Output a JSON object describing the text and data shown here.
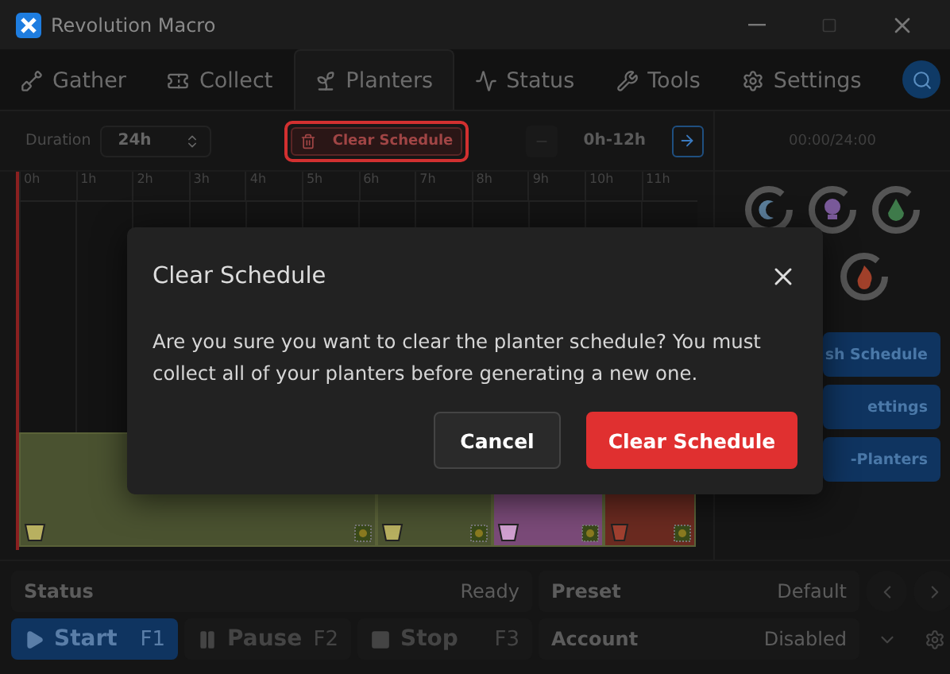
{
  "window": {
    "title": "Revolution Macro"
  },
  "tabs": [
    {
      "label": "Gather",
      "selected": false
    },
    {
      "label": "Collect",
      "selected": false
    },
    {
      "label": "Planters",
      "selected": true
    },
    {
      "label": "Status",
      "selected": false
    },
    {
      "label": "Tools",
      "selected": false
    },
    {
      "label": "Settings",
      "selected": false
    }
  ],
  "toolbar": {
    "duration_label": "Duration",
    "duration_value": "24h",
    "clear_button": "Clear Schedule",
    "range": "0h-12h",
    "clock": "00:00/24:00"
  },
  "timeline": {
    "hours": [
      "0h",
      "1h",
      "2h",
      "3h",
      "4h",
      "5h",
      "6h",
      "7h",
      "8h",
      "9h",
      "10h",
      "11h"
    ],
    "planters": [
      {
        "color": "#4a5230",
        "kind": "bucket"
      },
      {
        "color": "#4a5230",
        "kind": "bucket"
      },
      {
        "color": "#7a4a78",
        "kind": "bowl"
      },
      {
        "color": "#6a2a20",
        "kind": "pot"
      }
    ]
  },
  "fields": [
    {
      "kind": "moon",
      "color": "#5a7d9a"
    },
    {
      "kind": "bulb",
      "color": "#7a5a9a"
    },
    {
      "kind": "drop",
      "color": "#3e7a4a"
    },
    {
      "kind": "flame",
      "color": "#a0402a"
    }
  ],
  "side_buttons": [
    "sh Schedule",
    "ettings",
    "-Planters"
  ],
  "dialog": {
    "title": "Clear Schedule",
    "message": "Are you sure you want to clear the planter schedule? You must collect all of your planters before generating a new one.",
    "buttons": [
      {
        "label": "Cancel",
        "kind": "secondary"
      },
      {
        "label": "Clear Schedule",
        "kind": "danger"
      }
    ]
  },
  "status": {
    "label": "Status",
    "value": "Ready"
  },
  "preset": {
    "label": "Preset",
    "value": "Default"
  },
  "controls": [
    {
      "label": "Start",
      "key": "F1",
      "kind": "play",
      "selected": true
    },
    {
      "label": "Pause",
      "key": "F2",
      "kind": "pause",
      "selected": false
    },
    {
      "label": "Stop",
      "key": "F3",
      "kind": "stop",
      "selected": false
    }
  ],
  "account": {
    "label": "Account",
    "value": "Disabled"
  }
}
